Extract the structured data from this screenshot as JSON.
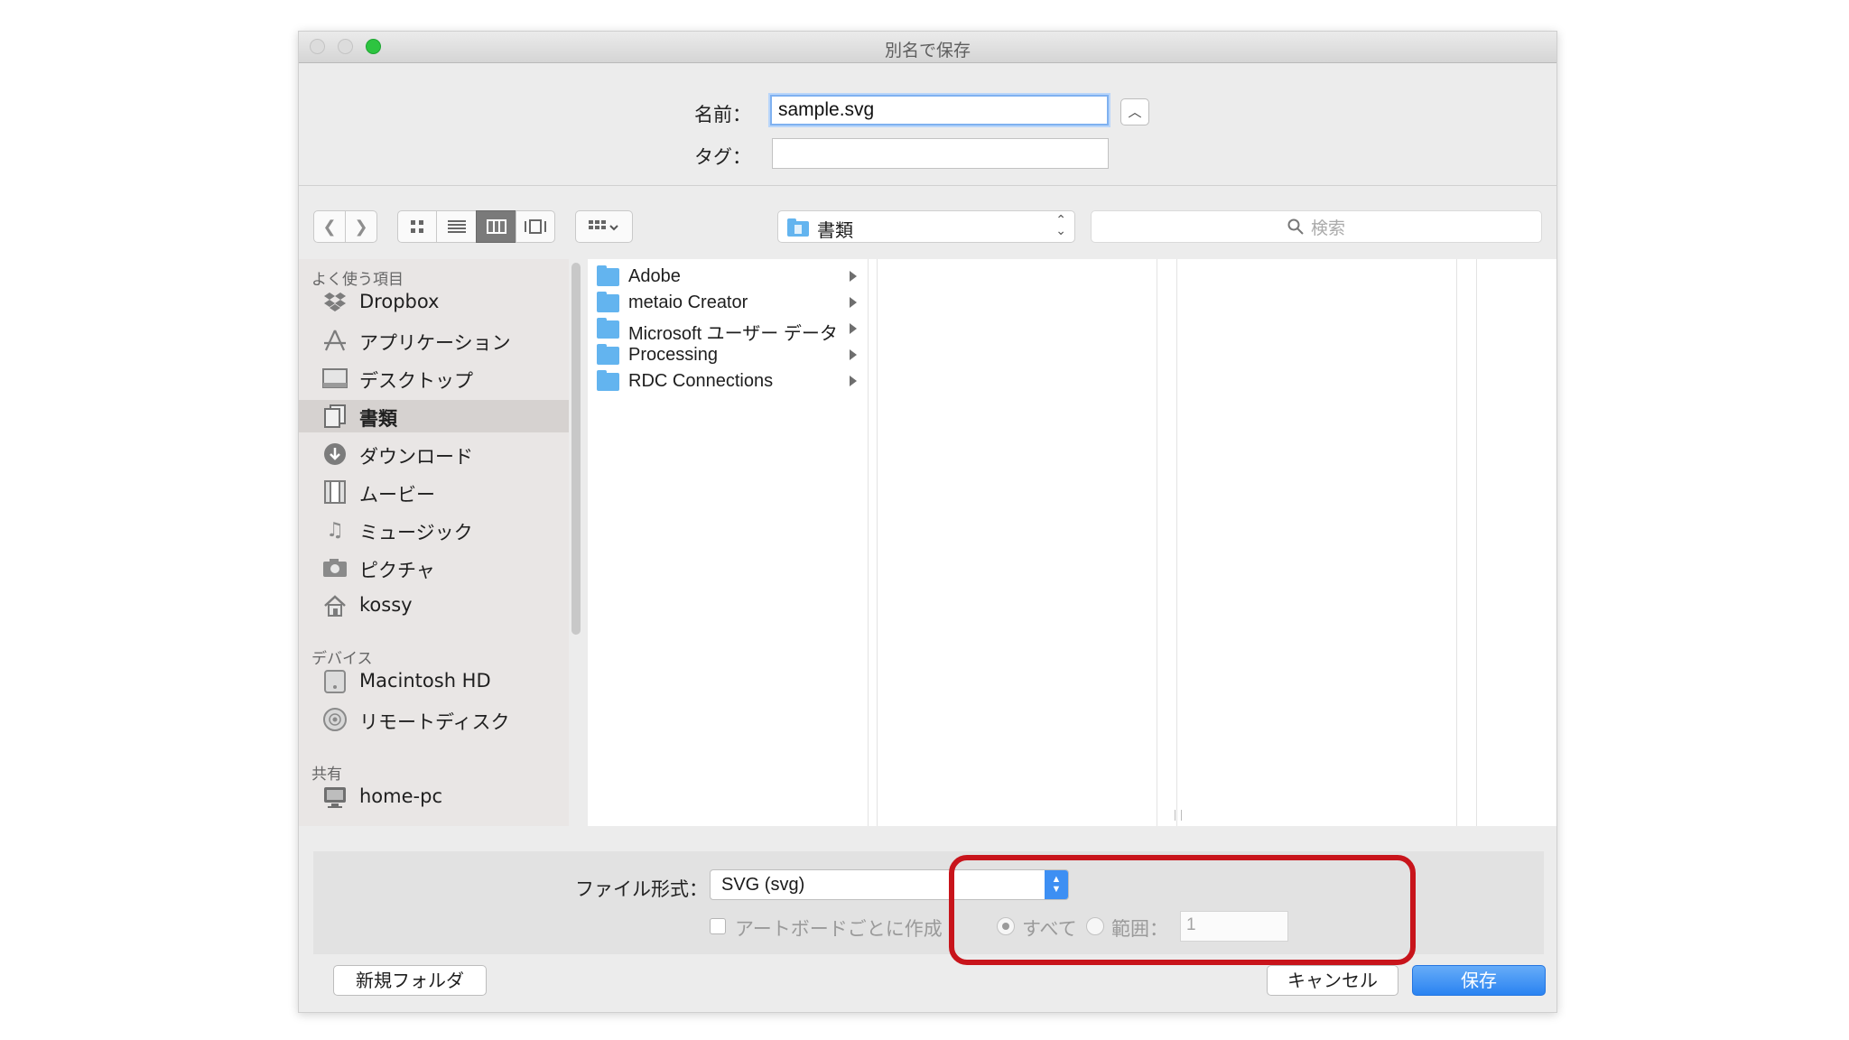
{
  "window": {
    "title": "別名で保存"
  },
  "fields": {
    "name_label": "名前：",
    "name_value": "sample.svg",
    "tag_label": "タグ：",
    "tag_value": ""
  },
  "toolbar": {
    "view_icons": [
      "icon-view-icon",
      "list-view-icon",
      "column-view-icon",
      "coverflow-view-icon",
      "arrange-icon"
    ],
    "location": "書類",
    "search_placeholder": "検索"
  },
  "sidebar": {
    "sections": [
      {
        "title": "よく使う項目",
        "items": [
          {
            "label": "Dropbox",
            "icon": "dropbox-icon"
          },
          {
            "label": "アプリケーション",
            "icon": "applications-icon"
          },
          {
            "label": "デスクトップ",
            "icon": "desktop-icon"
          },
          {
            "label": "書類",
            "icon": "documents-icon",
            "selected": true
          },
          {
            "label": "ダウンロード",
            "icon": "download-icon"
          },
          {
            "label": "ムービー",
            "icon": "movies-icon"
          },
          {
            "label": "ミュージック",
            "icon": "music-icon"
          },
          {
            "label": "ピクチャ",
            "icon": "pictures-icon"
          },
          {
            "label": "kossy",
            "icon": "home-icon"
          }
        ]
      },
      {
        "title": "デバイス",
        "items": [
          {
            "label": "Macintosh HD",
            "icon": "hard-drive-icon"
          },
          {
            "label": "リモートディスク",
            "icon": "remote-disc-icon"
          }
        ]
      },
      {
        "title": "共有",
        "items": [
          {
            "label": "home-pc",
            "icon": "computer-icon"
          }
        ]
      }
    ]
  },
  "browser": {
    "folders": [
      "Adobe",
      "metaio Creator",
      "Microsoft ユーザー データ",
      "Processing",
      "RDC Connections"
    ]
  },
  "options": {
    "format_label": "ファイル形式：",
    "format_value": "SVG (svg)",
    "artboard_label": "アートボードごとに作成",
    "all_label": "すべて",
    "range_label": "範囲：",
    "range_value": "1"
  },
  "buttons": {
    "new_folder": "新規フォルダ",
    "cancel": "キャンセル",
    "save": "保存"
  },
  "colors": {
    "accent": "#3d8ff3",
    "highlight": "#c8141b",
    "folder": "#63b4ef"
  }
}
